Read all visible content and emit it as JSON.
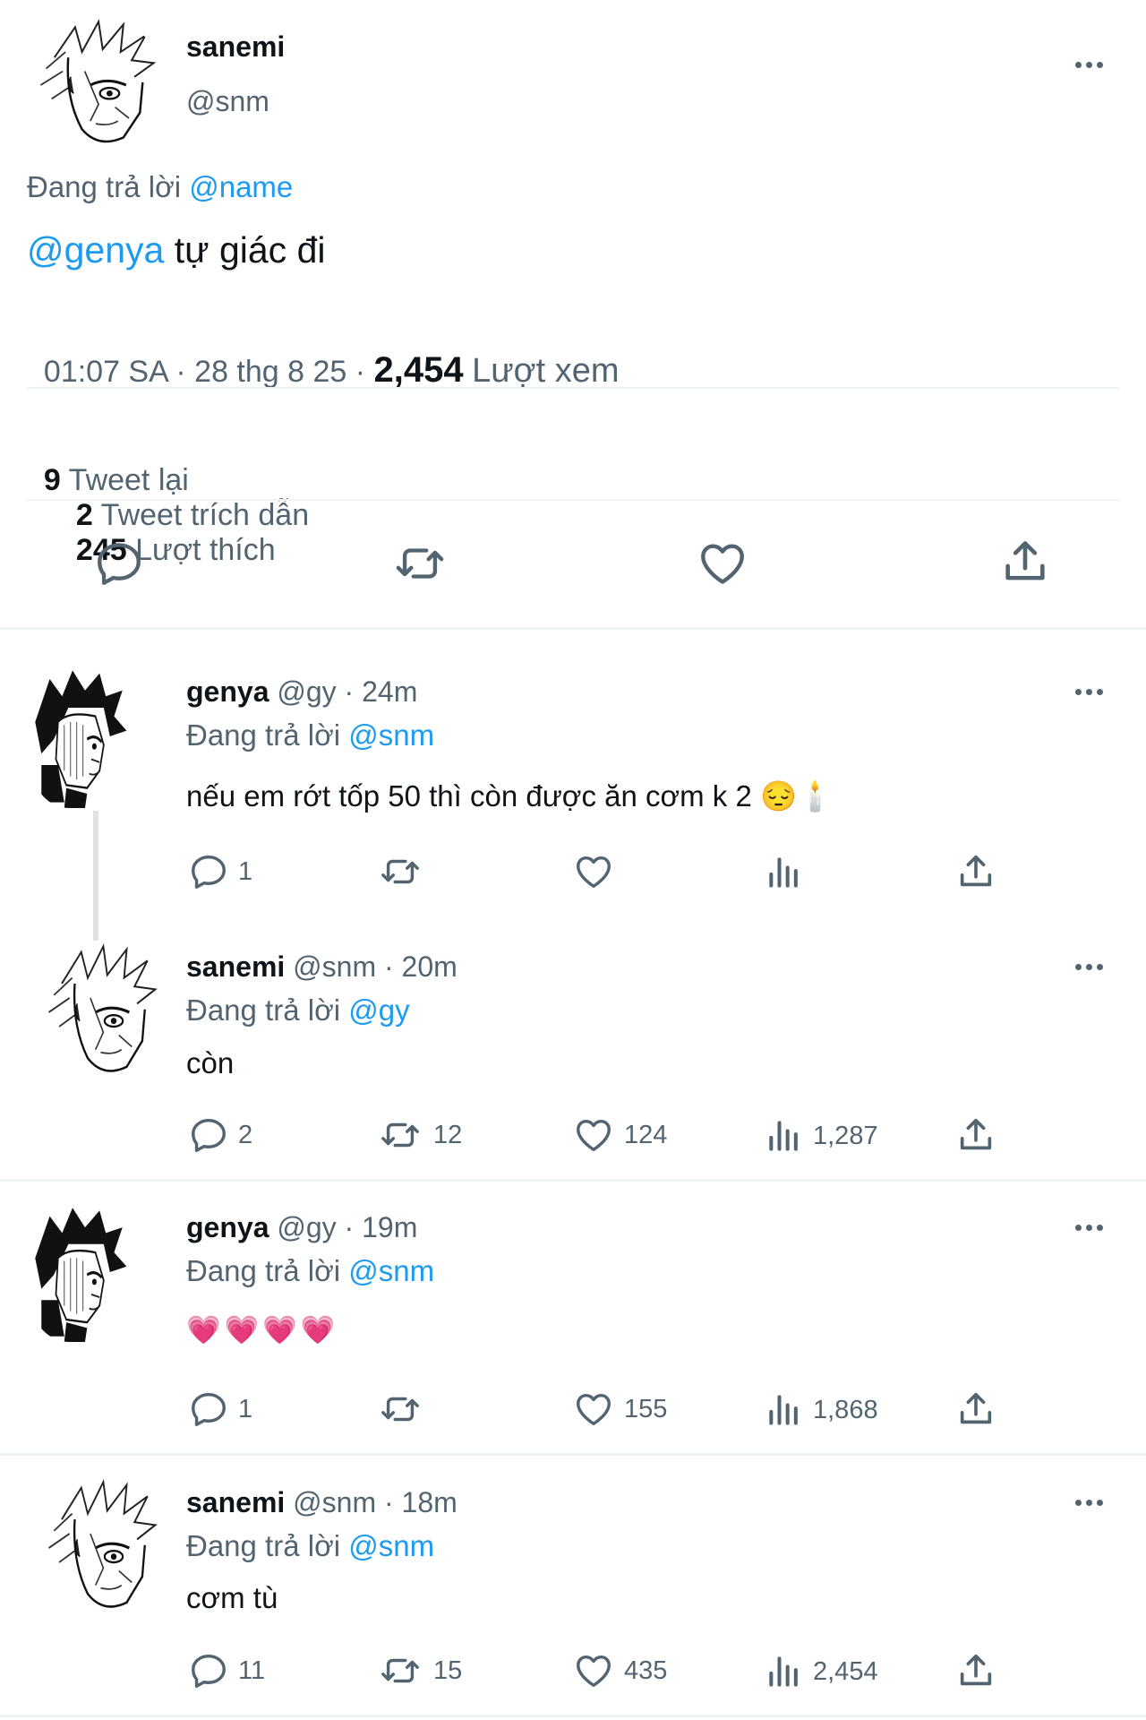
{
  "main_tweet": {
    "display_name": "sanemi",
    "handle": "@snm",
    "replying_prefix": "Đang trả lời",
    "replying_to": "@name",
    "mention": "@genya",
    "text": " tự giác đi",
    "time": "01:07 SA",
    "date": "28 thg 8 25",
    "sep": "·",
    "views_count": "2,454",
    "views_label": "Lượt xem",
    "stats": [
      {
        "count": "9",
        "label": "Tweet lại"
      },
      {
        "count": "2",
        "label": "Tweet trích dẫn"
      },
      {
        "count": "245",
        "label": "Lượt thích"
      }
    ]
  },
  "replies": [
    {
      "display_name": "genya",
      "handle": "@gy",
      "time": "24m",
      "replying_prefix": "Đang trả lời",
      "replying_to": "@snm",
      "text": "nếu em rớt tốp 50 thì còn được ăn cơm k 2 😔🕯️",
      "replies": "1",
      "retweets": "",
      "likes": "",
      "views": ""
    },
    {
      "display_name": "sanemi",
      "handle": "@snm",
      "time": "20m",
      "replying_prefix": "Đang trả lời",
      "replying_to": "@gy",
      "text": "còn",
      "replies": "2",
      "retweets": "12",
      "likes": "124",
      "views": "1,287"
    },
    {
      "display_name": "genya",
      "handle": "@gy",
      "time": "19m",
      "replying_prefix": "Đang trả lời",
      "replying_to": "@snm",
      "text": "💗💗💗💗",
      "replies": "1",
      "retweets": "",
      "likes": "155",
      "views": "1,868"
    },
    {
      "display_name": "sanemi",
      "handle": "@snm",
      "time": "18m",
      "replying_prefix": "Đang trả lời",
      "replying_to": "@snm",
      "text": "cơm tù",
      "replies": "11",
      "retweets": "15",
      "likes": "435",
      "views": "2,454"
    }
  ],
  "icons": {
    "reply": "reply-icon",
    "retweet": "retweet-icon",
    "like": "heart-icon",
    "views": "views-icon",
    "share": "share-icon",
    "more": "more-icon"
  },
  "colors": {
    "accent": "#1d9bf0",
    "text": "#0f1419",
    "muted": "#536471",
    "divider": "#eff3f4"
  }
}
